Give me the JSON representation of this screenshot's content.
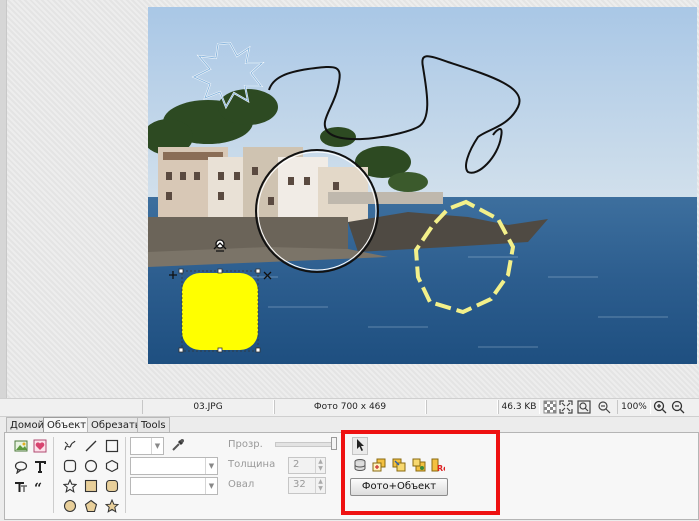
{
  "status_bar": {
    "filename": "03.JPG",
    "photo_info": "Фото 700 x 469",
    "file_size": "46.3 KB",
    "zoom": "100%"
  },
  "tabs": [
    {
      "label": "Домой"
    },
    {
      "label": "Объект"
    },
    {
      "label": "Обрезать"
    },
    {
      "label": "Tools"
    }
  ],
  "ribbon": {
    "opacity_label": "Прозр.",
    "thickness_label": "Толщина",
    "thickness_value": "2",
    "oval_label": "Овал",
    "oval_value": "32",
    "combo_photo_object": "Фото+Объект"
  },
  "colors": {
    "highlight": "#ee1111",
    "yellow_shape": "#ffff00",
    "dashed_outline": "#f3f08a"
  }
}
